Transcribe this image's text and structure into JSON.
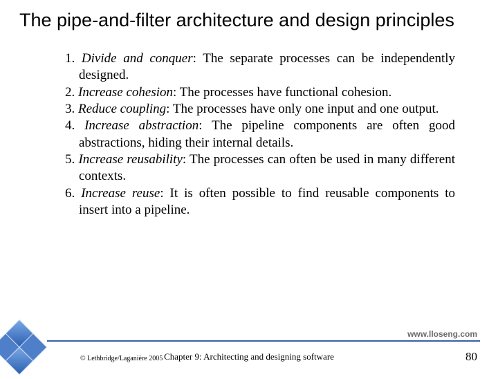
{
  "title": "The pipe-and-filter architecture and design principles",
  "principles": [
    {
      "num": "1.",
      "name": "Divide and conquer",
      "desc": ": The separate processes can be independently designed."
    },
    {
      "num": "2.",
      "name": "Increase cohesion",
      "desc": ": The processes have functional cohesion."
    },
    {
      "num": "3.",
      "name": "Reduce coupling",
      "desc": ": The processes have only one input and one output."
    },
    {
      "num": "4.",
      "name": "Increase abstraction",
      "desc": ": The pipeline components are often good abstractions, hiding their internal details."
    },
    {
      "num": "5.",
      "name": "Increase reusability",
      "desc": ": The processes can often be used in many different contexts."
    },
    {
      "num": "6.",
      "name": "Increase reuse",
      "desc": ": It is often possible to find reusable components to insert into a pipeline."
    }
  ],
  "footer": {
    "website": "www.lloseng.com",
    "copyright": "© Lethbridge/Laganière 2005",
    "chapter": "Chapter 9: Architecting and designing software",
    "page": "80"
  }
}
